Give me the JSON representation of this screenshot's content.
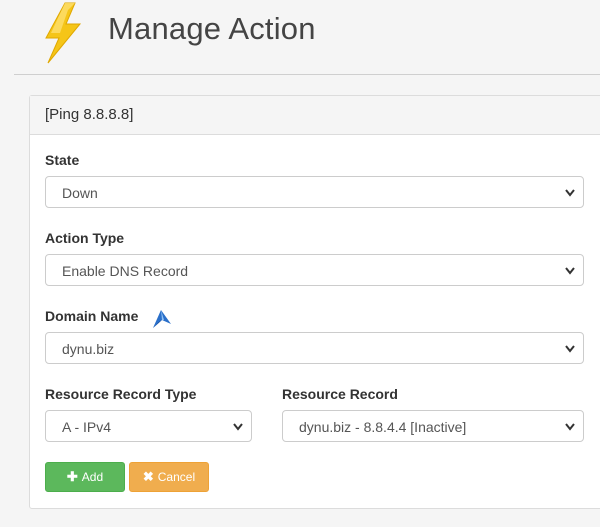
{
  "header": {
    "title": "Manage Action"
  },
  "panel": {
    "title": "[Ping 8.8.8.8]"
  },
  "form": {
    "state": {
      "label": "State",
      "value": "Down"
    },
    "action_type": {
      "label": "Action Type",
      "value": "Enable DNS Record"
    },
    "domain_name": {
      "label": "Domain Name",
      "value": "dynu.biz"
    },
    "resource_record_type": {
      "label": "Resource Record Type",
      "value": "A - IPv4"
    },
    "resource_record": {
      "label": "Resource Record",
      "value": "dynu.biz - 8.8.4.4 [Inactive]"
    }
  },
  "buttons": {
    "add": {
      "label": "Add",
      "icon": "plus-icon"
    },
    "cancel": {
      "label": "Cancel",
      "icon": "times-icon"
    }
  },
  "colors": {
    "add_button": "#5cb85c",
    "cancel_button": "#f0ad4e",
    "bolt": "#f5c518"
  }
}
